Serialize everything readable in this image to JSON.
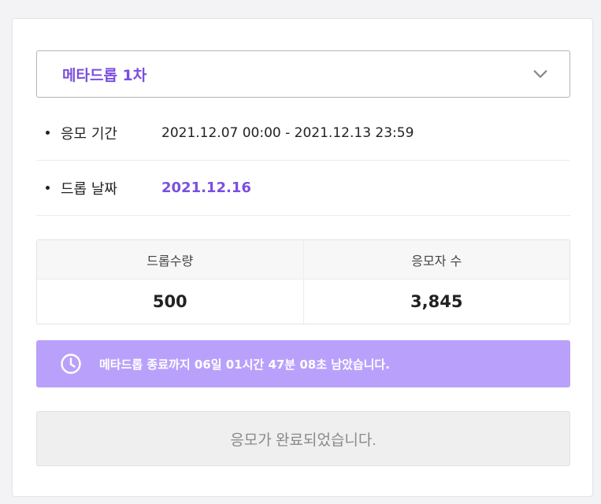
{
  "drop_select": {
    "selected": "메타드롭 1차",
    "icon": "chevron-down-icon"
  },
  "info": {
    "period_label": "응모 기간",
    "period_value": "2021.12.07 00:00 - 2021.12.13 23:59",
    "drop_date_label": "드롭 날짜",
    "drop_date_value": "2021.12.16"
  },
  "stats": {
    "quantity_label": "드롭수량",
    "quantity_value": "500",
    "applicants_label": "응모자 수",
    "applicants_value": "3,845"
  },
  "timer": {
    "icon": "clock-icon",
    "text": "메타드롭 종료까지 06일 01시간 47분 08초 남았습니다."
  },
  "status_button": {
    "label": "응모가 완료되었습니다."
  },
  "colors": {
    "accent": "#7b4fe0",
    "timer_bg": "#b9a1fb",
    "disabled_bg": "#efefef"
  }
}
